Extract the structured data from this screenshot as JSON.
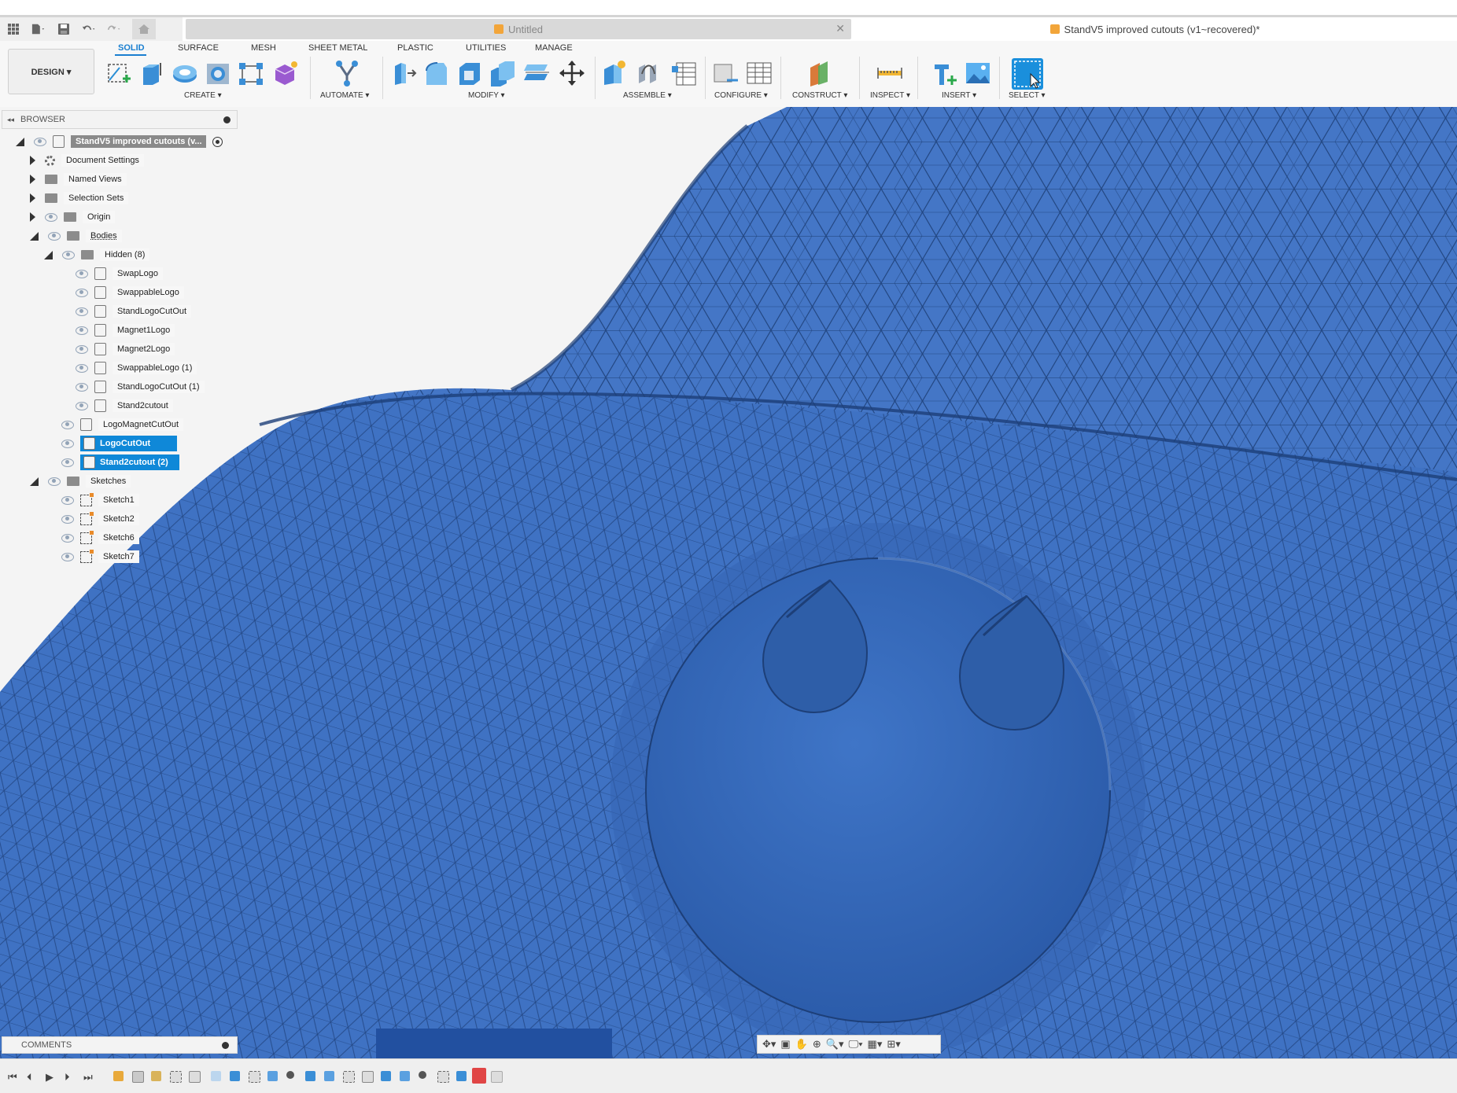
{
  "quick_access": {
    "apps_icon": "grid-icon",
    "file_icon": "file-icon",
    "save_icon": "save-icon",
    "undo_icon": "undo-icon",
    "redo_icon": "redo-icon",
    "home_icon": "home-icon"
  },
  "tabs": {
    "untitled": "Untitled",
    "document": "StandV5 improved cutouts (v1~recovered)*"
  },
  "workspace": {
    "label": "DESIGN ▾"
  },
  "ribbon_tabs": [
    "SOLID",
    "SURFACE",
    "MESH",
    "SHEET METAL",
    "PLASTIC",
    "UTILITIES",
    "MANAGE"
  ],
  "ribbon_groups": {
    "create": "CREATE ▾",
    "automate": "AUTOMATE ▾",
    "modify": "MODIFY ▾",
    "assemble": "ASSEMBLE ▾",
    "configure": "CONFIGURE ▾",
    "construct": "CONSTRUCT ▾",
    "inspect": "INSPECT ▾",
    "insert": "INSERT ▾",
    "select": "SELECT ▾"
  },
  "browser": {
    "title": "BROWSER",
    "root": "StandV5 improved cutouts (v...",
    "items": {
      "document_settings": "Document Settings",
      "named_views": "Named Views",
      "selection_sets": "Selection Sets",
      "origin": "Origin",
      "bodies": "Bodies",
      "hidden": "Hidden (8)",
      "swaplogo": "SwapLogo",
      "swappablelogo": "SwappableLogo",
      "standlogocutout": "StandLogoCutOut",
      "magnet1logo": "Magnet1Logo",
      "magnet2logo": "Magnet2Logo",
      "swappablelogo1": "SwappableLogo (1)",
      "standlogocutout1": "StandLogoCutOut (1)",
      "stand2cutout": "Stand2cutout",
      "logomagnetcutout": "LogoMagnetCutOut",
      "logocutout": "LogoCutOut",
      "stand2cutout2": "Stand2cutout (2)",
      "sketches": "Sketches",
      "sketch1": "Sketch1",
      "sketch2": "Sketch2",
      "sketch6": "Sketch6",
      "sketch7": "Sketch7"
    }
  },
  "comments": {
    "title": "COMMENTS"
  },
  "colors": {
    "accent": "#1a7fd0",
    "selection": "#0f88d8",
    "mesh_body": "#3f72c3",
    "mesh_edge": "#1d3f78"
  }
}
